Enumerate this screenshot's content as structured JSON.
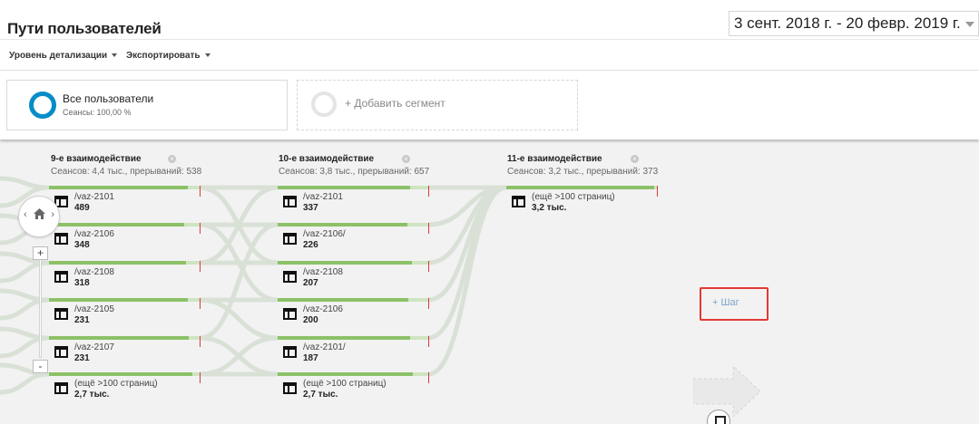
{
  "header": {
    "title": "Пути пользователей",
    "date_range": "3 сент. 2018 г. - 20 февр. 2019 г."
  },
  "toolbar": {
    "detail_label": "Уровень детализации",
    "export_label": "Экспортировать"
  },
  "segments": {
    "active": {
      "name": "Все пользователи",
      "sub": "Сеансы: 100,00 %"
    },
    "add_label": "+ Добавить сегмент"
  },
  "columns": [
    {
      "title": "9-е взаимодействие",
      "stats": "Сеансов: 4,4 тыс., прерываний: 538",
      "nodes": [
        {
          "label": "/vaz-2101",
          "count": "489"
        },
        {
          "label": "/vaz-2106",
          "count": "348"
        },
        {
          "label": "/vaz-2108",
          "count": "318"
        },
        {
          "label": "/vaz-2105",
          "count": "231"
        },
        {
          "label": "/vaz-2107",
          "count": "231"
        },
        {
          "label": "(ещё >100 страниц)",
          "count": "2,7 тыс."
        }
      ]
    },
    {
      "title": "10-е взаимодействие",
      "stats": "Сеансов: 3,8 тыс., прерываний: 657",
      "nodes": [
        {
          "label": "/vaz-2101",
          "count": "337"
        },
        {
          "label": "/vaz-2106/",
          "count": "226"
        },
        {
          "label": "/vaz-2108",
          "count": "207"
        },
        {
          "label": "/vaz-2106",
          "count": "200"
        },
        {
          "label": "/vaz-2101/",
          "count": "187"
        },
        {
          "label": "(ещё >100 страниц)",
          "count": "2,7 тыс."
        }
      ]
    },
    {
      "title": "11-е взаимодействие",
      "stats": "Сеансов: 3,2 тыс., прерываний: 373",
      "nodes": [
        {
          "label": "(ещё >100 страниц)",
          "count": "3,2 тыс."
        }
      ]
    }
  ],
  "step": {
    "label": "+ Шаг"
  },
  "zoom": {
    "plus": "+",
    "minus": "-"
  },
  "nav": {
    "left": "‹",
    "right": "›"
  },
  "colors": {
    "accent": "#058dc7",
    "flow_bar": "#8cc168",
    "dropoff": "#d93b3b",
    "highlight": "#e53935"
  }
}
